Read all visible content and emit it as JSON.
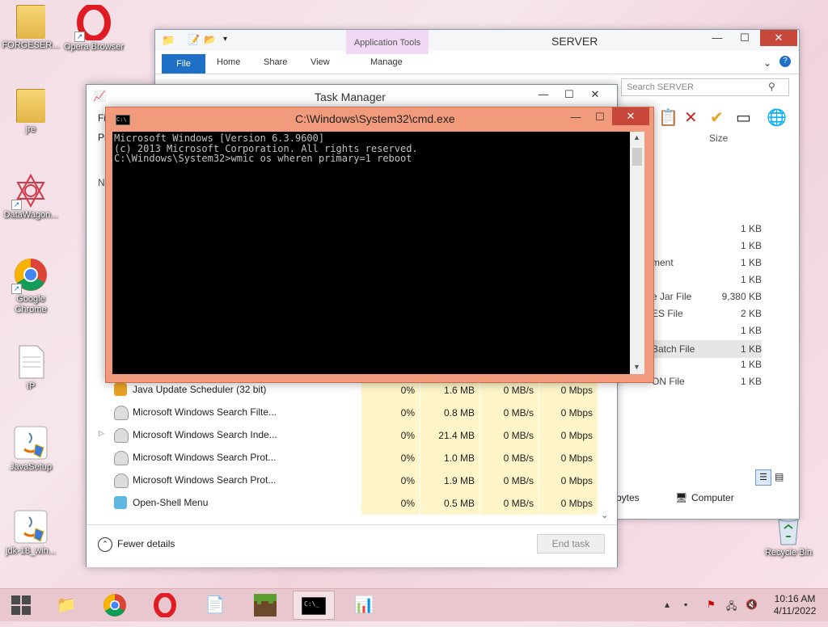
{
  "desktop": {
    "icons": [
      {
        "label": "FORGESER...",
        "kind": "folder"
      },
      {
        "label": "Opera Browser",
        "kind": "opera"
      },
      {
        "label": "jre",
        "kind": "folder"
      },
      {
        "label": "DataWagon...",
        "kind": "datawagon"
      },
      {
        "label": "Google Chrome",
        "kind": "chrome"
      },
      {
        "label": "IP",
        "kind": "file"
      },
      {
        "label": "JavaSetup",
        "kind": "java"
      },
      {
        "label": "jdk-18_win...",
        "kind": "java"
      },
      {
        "label": "Recycle Bin",
        "kind": "recycle"
      }
    ]
  },
  "explorer": {
    "title": "SERVER",
    "context_tab": "Application Tools",
    "tabs": [
      "File",
      "Home",
      "Share",
      "View",
      "Manage"
    ],
    "search_placeholder": "Search SERVER",
    "size_header": "Size",
    "rows": [
      {
        "type": "",
        "size": "1 KB"
      },
      {
        "type": "",
        "size": "1 KB"
      },
      {
        "type": "ment",
        "size": "1 KB"
      },
      {
        "type": "",
        "size": "1 KB"
      },
      {
        "type": "e Jar File",
        "size": "9,380 KB"
      },
      {
        "type": "ES File",
        "size": "2 KB"
      },
      {
        "type": "",
        "size": "1 KB"
      },
      {
        "type": "Batch File",
        "size": "1 KB"
      },
      {
        "type": "",
        "size": "1 KB"
      },
      {
        "type": "ON File",
        "size": "1 KB"
      }
    ],
    "status_left": "bytes",
    "status_right": "Computer"
  },
  "taskmgr": {
    "title": "Task Manager",
    "menu_fragment": "Fil",
    "tab_fragment": "Pr",
    "col_fragment": "Na",
    "processes": [
      {
        "name": "Java Update Scheduler (32 bit)",
        "cpu": "0%",
        "mem": "1.6 MB",
        "disk": "0 MB/s",
        "net": "0 Mbps",
        "icon": "java",
        "expandable": false
      },
      {
        "name": "Microsoft Windows Search Filte...",
        "cpu": "0%",
        "mem": "0.8 MB",
        "disk": "0 MB/s",
        "net": "0 Mbps",
        "icon": "user",
        "expandable": false
      },
      {
        "name": "Microsoft Windows Search Inde...",
        "cpu": "0%",
        "mem": "21.4 MB",
        "disk": "0 MB/s",
        "net": "0 Mbps",
        "icon": "user",
        "expandable": true
      },
      {
        "name": "Microsoft Windows Search Prot...",
        "cpu": "0%",
        "mem": "1.0 MB",
        "disk": "0 MB/s",
        "net": "0 Mbps",
        "icon": "user",
        "expandable": false
      },
      {
        "name": "Microsoft Windows Search Prot...",
        "cpu": "0%",
        "mem": "1.9 MB",
        "disk": "0 MB/s",
        "net": "0 Mbps",
        "icon": "user",
        "expandable": false
      },
      {
        "name": "Open-Shell Menu",
        "cpu": "0%",
        "mem": "0.5 MB",
        "disk": "0 MB/s",
        "net": "0 Mbps",
        "icon": "shell",
        "expandable": false
      }
    ],
    "fewer_details": "Fewer details",
    "end_task": "End task"
  },
  "cmd": {
    "title": "C:\\Windows\\System32\\cmd.exe",
    "icon_text": "C:\\",
    "lines": [
      "Microsoft Windows [Version 6.3.9600]",
      "(c) 2013 Microsoft Corporation. All rights reserved.",
      "",
      "C:\\Windows\\System32>wmic os wheren primary=1 reboot"
    ]
  },
  "taskbar": {
    "time": "10:16 AM",
    "date": "4/11/2022"
  },
  "colors": {
    "cmd_frame": "#f19b7c",
    "close_red": "#c7473a",
    "file_tab_blue": "#1e6fc6",
    "heatmap_yellow": "#fff5c9"
  }
}
